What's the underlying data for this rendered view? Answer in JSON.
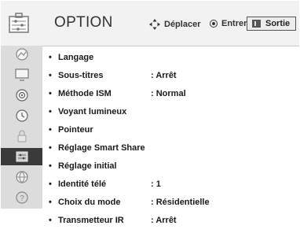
{
  "header": {
    "title": "OPTION",
    "move_label": "Déplacer",
    "enter_label": "Entrer",
    "exit_label": "Sortie"
  },
  "sidebar": {
    "items": [
      {
        "icon": "picture-icon",
        "active": false
      },
      {
        "icon": "monitor-icon",
        "active": false
      },
      {
        "icon": "audio-icon",
        "active": false
      },
      {
        "icon": "clock-icon",
        "active": false
      },
      {
        "icon": "lock-icon",
        "active": false
      },
      {
        "icon": "option-icon",
        "active": true
      },
      {
        "icon": "network-icon",
        "active": false
      },
      {
        "icon": "help-icon",
        "active": false
      }
    ]
  },
  "menu": {
    "items": [
      {
        "label": "Langage",
        "value": ""
      },
      {
        "label": "Sous-titres",
        "value": "Arrêt"
      },
      {
        "label": "Méthode ISM",
        "value": "Normal"
      },
      {
        "label": "Voyant lumineux",
        "value": ""
      },
      {
        "label": "Pointeur",
        "value": ""
      },
      {
        "label": "Réglage Smart Share",
        "value": ""
      },
      {
        "label": "Réglage initial",
        "value": ""
      },
      {
        "label": "Identité télé",
        "value": "1"
      },
      {
        "label": "Choix du mode",
        "value": "Résidentielle"
      },
      {
        "label": "Transmetteur IR",
        "value": "Arrêt"
      }
    ]
  },
  "colors": {
    "header_bg": "#f2f2f2",
    "sidebar_bg": "#dcdcdc",
    "sidebar_active": "#3a3a3a",
    "text": "#1a1a1a"
  }
}
